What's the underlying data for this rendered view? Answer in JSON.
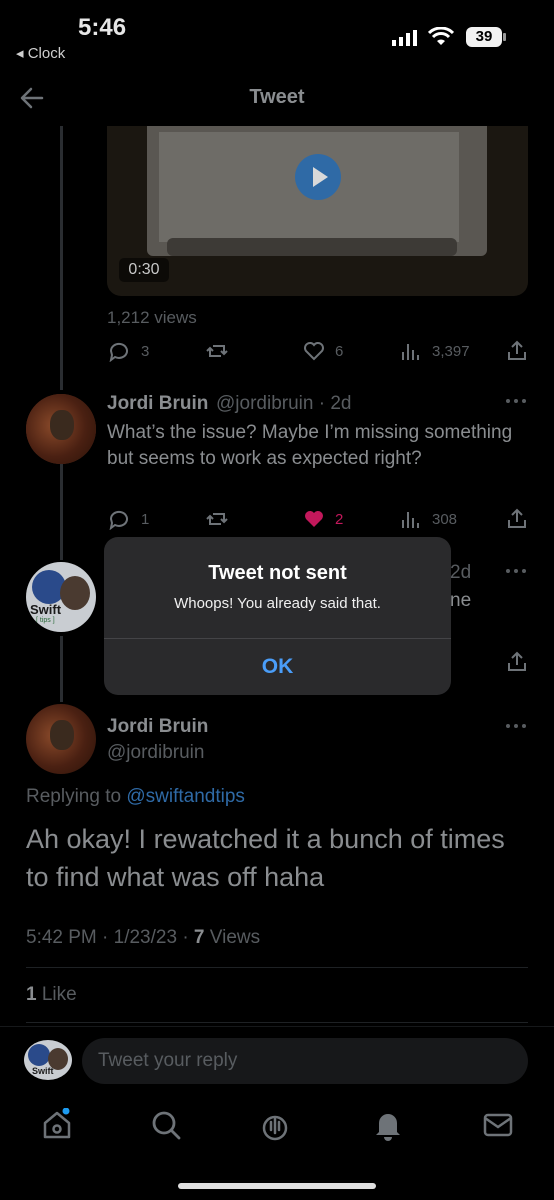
{
  "status_bar": {
    "time": "5:46",
    "back_app": "◂ Clock",
    "battery": "39"
  },
  "header": {
    "title": "Tweet"
  },
  "media": {
    "duration": "0:30",
    "views": "1,212 views"
  },
  "original_actions": {
    "replies": "3",
    "likes": "6",
    "views": "3,397"
  },
  "reply1": {
    "name": "Jordi Bruin",
    "handle_time": "@jordibruin · 2d",
    "text": "What’s the issue? Maybe I’m missing something but seems to work as expected right?",
    "replies": "1",
    "likes": "2",
    "views": "308"
  },
  "reply2": {
    "avatar_label": "Swift",
    "avatar_sub": "[ tips ]",
    "peek_right_1": "2d",
    "peek_right_2": "ne"
  },
  "dialog": {
    "title": "Tweet not sent",
    "message": "Whoops! You already said that.",
    "ok": "OK"
  },
  "main_tweet": {
    "name": "Jordi Bruin",
    "handle": "@jordibruin",
    "replying_prefix": "Replying to ",
    "replying_to": "@swiftandtips",
    "text": "Ah okay! I rewatched it a bunch of times to find what was off haha",
    "time_date": "5:42 PM · 1/23/23 · ",
    "views_count": "7",
    "views_label": " Views",
    "likes_count": "1",
    "likes_label": " Like"
  },
  "composer": {
    "placeholder": "Tweet your reply",
    "avatar_label": "Swift"
  },
  "colors": {
    "accent": "#4a9df8",
    "like": "#f91880",
    "background": "#000000"
  },
  "icons": [
    "back-arrow-icon",
    "play-icon",
    "reply-icon",
    "retweet-icon",
    "like-icon",
    "views-icon",
    "share-icon",
    "more-icon",
    "home-icon",
    "search-icon",
    "spaces-icon",
    "notifications-icon",
    "messages-icon"
  ]
}
